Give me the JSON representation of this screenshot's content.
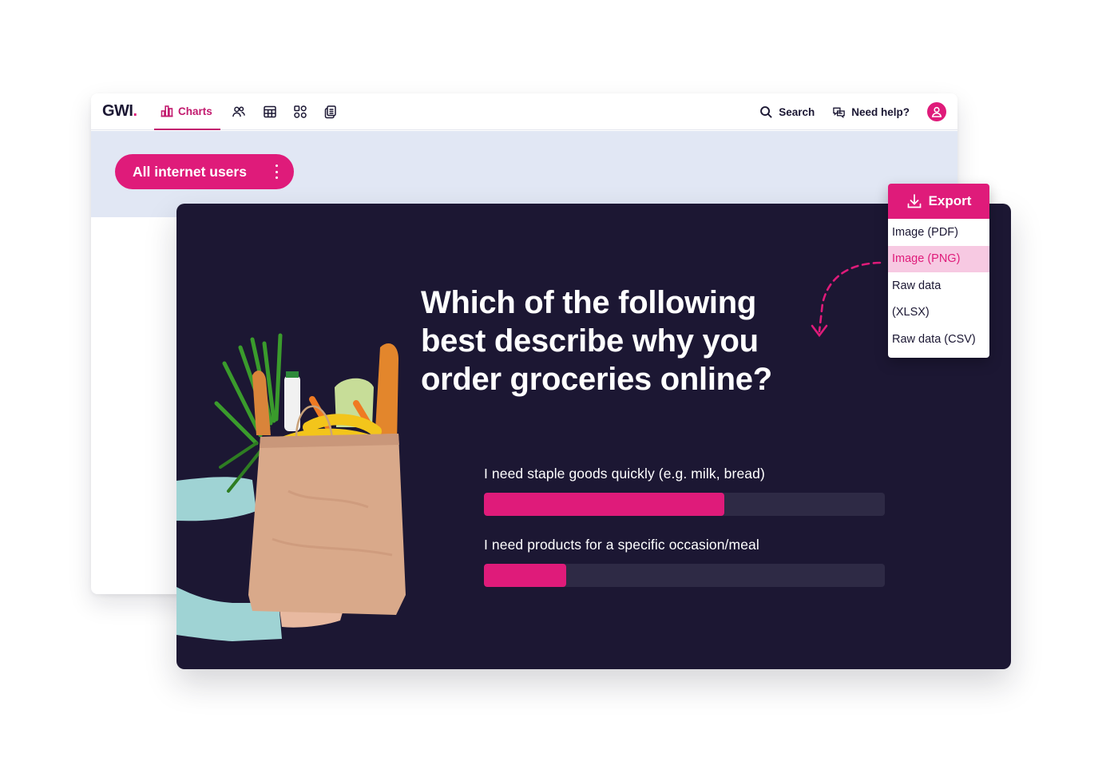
{
  "app": {
    "logo_text": "GWI",
    "logo_dot": ".",
    "nav": {
      "active_tab": {
        "label": "Charts",
        "icon": "bar-chart-icon"
      },
      "icon_tabs": [
        {
          "name": "audiences",
          "icon": "users-icon"
        },
        {
          "name": "crosstabs",
          "icon": "table-icon"
        },
        {
          "name": "dashboards",
          "icon": "grid-icon"
        },
        {
          "name": "reports",
          "icon": "copy-icon"
        }
      ]
    },
    "tools": {
      "search_label": "Search",
      "help_label": "Need help?"
    },
    "audience": {
      "label": "All internet users"
    }
  },
  "chart_card": {
    "question": "Which of the following best describe why you order groceries online?",
    "image_alt": "Hands holding a paper grocery bag with bread, bananas, carrots, greens and milk"
  },
  "chart_data": {
    "type": "bar",
    "orientation": "horizontal",
    "title": "Which of the following best describe why you order groceries online?",
    "categories": [
      "I need staple goods quickly (e.g. milk, bread)",
      "I need products for a specific occasion/meal"
    ],
    "values": [
      60,
      20.5
    ],
    "unit": "%",
    "xlim": [
      0,
      100
    ],
    "grid": false,
    "legend": "none"
  },
  "export_menu": {
    "title": "Export",
    "items": [
      {
        "label": "Image (PDF)",
        "active": false
      },
      {
        "label": "Image (PNG)",
        "active": true
      },
      {
        "label": "Raw data",
        "active": false
      },
      {
        "label": "(XLSX)",
        "active": false
      },
      {
        "label": "Raw data (CSV)",
        "active": false
      }
    ]
  },
  "colors": {
    "brand_pink": "#df1b7a",
    "card_bg": "#1c1733",
    "track": "#2e2a45",
    "band": "#e1e7f4",
    "active_item_bg": "#f7c9e2"
  }
}
